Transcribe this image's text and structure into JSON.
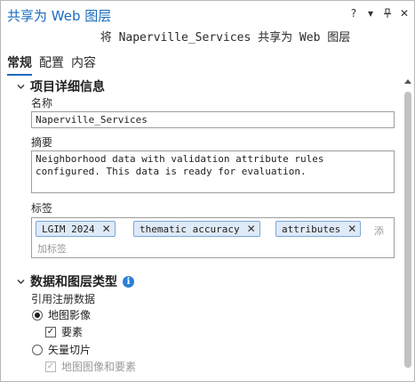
{
  "window": {
    "title": "共享为 Web 图层",
    "subtitle": "将 Naperville_Services 共享为 Web 图层",
    "controls": [
      "?",
      "▾",
      "⊥",
      "✕"
    ]
  },
  "tabs": [
    {
      "label": "常规",
      "active": true
    },
    {
      "label": "配置",
      "active": false
    },
    {
      "label": "内容",
      "active": false
    }
  ],
  "details": {
    "heading": "项目详细信息",
    "name_label": "名称",
    "name_value": "Naperville_Services",
    "summary_label": "摘要",
    "summary_value": "Neighborhood data with validation attribute rules configured. This data is ready for evaluation.",
    "tags_label": "标签",
    "tags": [
      "LGIM 2024",
      "thematic accuracy",
      "attributes"
    ],
    "tag_placeholder_1": "添",
    "tag_placeholder_2": "加标签"
  },
  "layer_type": {
    "heading": "数据和图层类型",
    "info_icon": "i",
    "ref_label": "引用注册数据",
    "map_image": "地图影像",
    "features": "要素",
    "vector_tile": "矢量切片",
    "map_image_and_features": "地图图像和要素"
  },
  "colors": {
    "accent": "#1a6bbf",
    "tag_bg": "#dfeaf7",
    "tag_border": "#7aa7d6"
  }
}
